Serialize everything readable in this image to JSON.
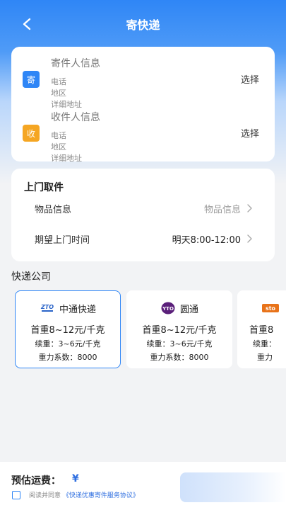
{
  "header": {
    "title": "寄快递"
  },
  "sender": {
    "badge": "寄",
    "title": "寄件人信息",
    "phone": "电话",
    "region": "地区",
    "address": "详细地址",
    "action": "选择",
    "badge_color": "#2f86f6"
  },
  "receiver": {
    "badge": "收",
    "title": "收件人信息",
    "phone": "电话",
    "region": "地区",
    "address": "详细地址",
    "action": "选择",
    "badge_color": "#f5a623"
  },
  "pickup": {
    "title": "上门取件",
    "rows": [
      {
        "label": "物品信息",
        "value": "物品信息"
      },
      {
        "label": "期望上门时间",
        "value": "明天8:00-12:00"
      }
    ]
  },
  "couriers": {
    "label": "快递公司",
    "items": [
      {
        "name": "中通快递",
        "logo": "zto-logo",
        "first_weight": "首重8~12元/千克",
        "continued": "续重：3~6元/千克",
        "ratio": "重力系数：8000",
        "selected": true
      },
      {
        "name": "圆通",
        "logo": "yto-logo",
        "first_weight": "首重8~12元/千克",
        "continued": "续重：3~6元/千克",
        "ratio": "重力系数：8000",
        "selected": false
      },
      {
        "name": "",
        "logo": "sto-logo",
        "first_weight": "首重8",
        "continued": "续重：",
        "ratio": "重力",
        "selected": false
      }
    ]
  },
  "footer": {
    "fee_label": "预估运费：",
    "currency": "¥",
    "agree_prefix": "阅读并同意",
    "agree_link": "《快递优惠寄件服务协议》"
  },
  "colors": {
    "accent": "#2f86f6",
    "link": "#2f6fe0"
  }
}
